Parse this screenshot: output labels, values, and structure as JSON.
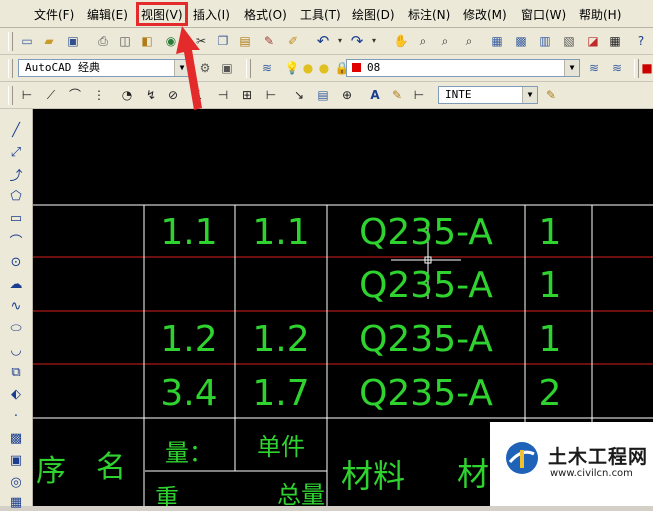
{
  "menu": {
    "items": [
      "文件(F)",
      "编辑(E)",
      "视图(V)",
      "插入(I)",
      "格式(O)",
      "工具(T)",
      "绘图(D)",
      "标注(N)",
      "修改(M)",
      "窗口(W)",
      "帮助(H)"
    ],
    "highlighted": "视图(V)"
  },
  "toolbar_styles": {
    "workspace_value": "AutoCAD 经典",
    "layer_value": "08",
    "dim_style_value": "INTE"
  },
  "toolbar_icons": {
    "standard": [
      "new-icon",
      "open-icon",
      "save-icon",
      "print-icon",
      "preview-icon",
      "publish-icon",
      "3d-dwf-icon",
      "cut-icon",
      "copy-icon",
      "paste-icon",
      "match-properties-icon",
      "block-editor-icon",
      "undo-icon",
      "redo-icon",
      "pan-icon",
      "zoom-realtime-icon",
      "zoom-window-icon",
      "zoom-previous-icon",
      "properties-icon",
      "design-center-icon",
      "tool-palettes-icon",
      "sheet-set-icon",
      "markup-icon",
      "calculator-icon",
      "help-icon"
    ],
    "dimension": [
      "linear-dim-icon",
      "aligned-dim-icon",
      "arc-length-icon",
      "ordinate-icon",
      "radius-icon",
      "jogged-icon",
      "diameter-icon",
      "angular-icon",
      "quick-dim-icon",
      "baseline-icon",
      "continue-icon",
      "leader-icon",
      "tolerance-icon",
      "center-mark-icon",
      "dim-edit-icon",
      "dim-text-edit-icon",
      "dim-update-icon",
      "dim-style-icon"
    ],
    "draw": [
      "line-icon",
      "construction-line-icon",
      "polyline-icon",
      "polygon-icon",
      "rectangle-icon",
      "arc-icon",
      "circle-icon",
      "revision-cloud-icon",
      "spline-icon",
      "ellipse-icon",
      "ellipse-arc-icon",
      "insert-block-icon",
      "make-block-icon",
      "point-icon",
      "hatch-icon",
      "gradient-icon",
      "region-icon",
      "table-icon"
    ]
  },
  "drawing": {
    "rows": [
      {
        "c1": "1.1",
        "c2": "1.1",
        "c3": "Q235-A",
        "c4": "1"
      },
      {
        "c1": "",
        "c2": "",
        "c3": "Q235-A",
        "c4": "1"
      },
      {
        "c1": "1.2",
        "c2": "1.2",
        "c3": "Q235-A",
        "c4": "1"
      },
      {
        "c1": "3.4",
        "c2": "1.7",
        "c3": "Q235-A",
        "c4": "2"
      }
    ],
    "header_bottom": {
      "c1": "量：",
      "c2": "单件",
      "c3": "材料",
      "left_a": "序",
      "left_b": "名",
      "right_partial": "材"
    },
    "header_partial": {
      "left": "重",
      "mid": "总量"
    }
  },
  "colors": {
    "cad_text": "#2fd32f",
    "cad_red_line": "#d81e1e",
    "annotation_red": "#e32b2b",
    "canvas_bg": "#000000"
  },
  "watermark": {
    "title": "土木工程网",
    "url": "www.civilcn.com"
  }
}
